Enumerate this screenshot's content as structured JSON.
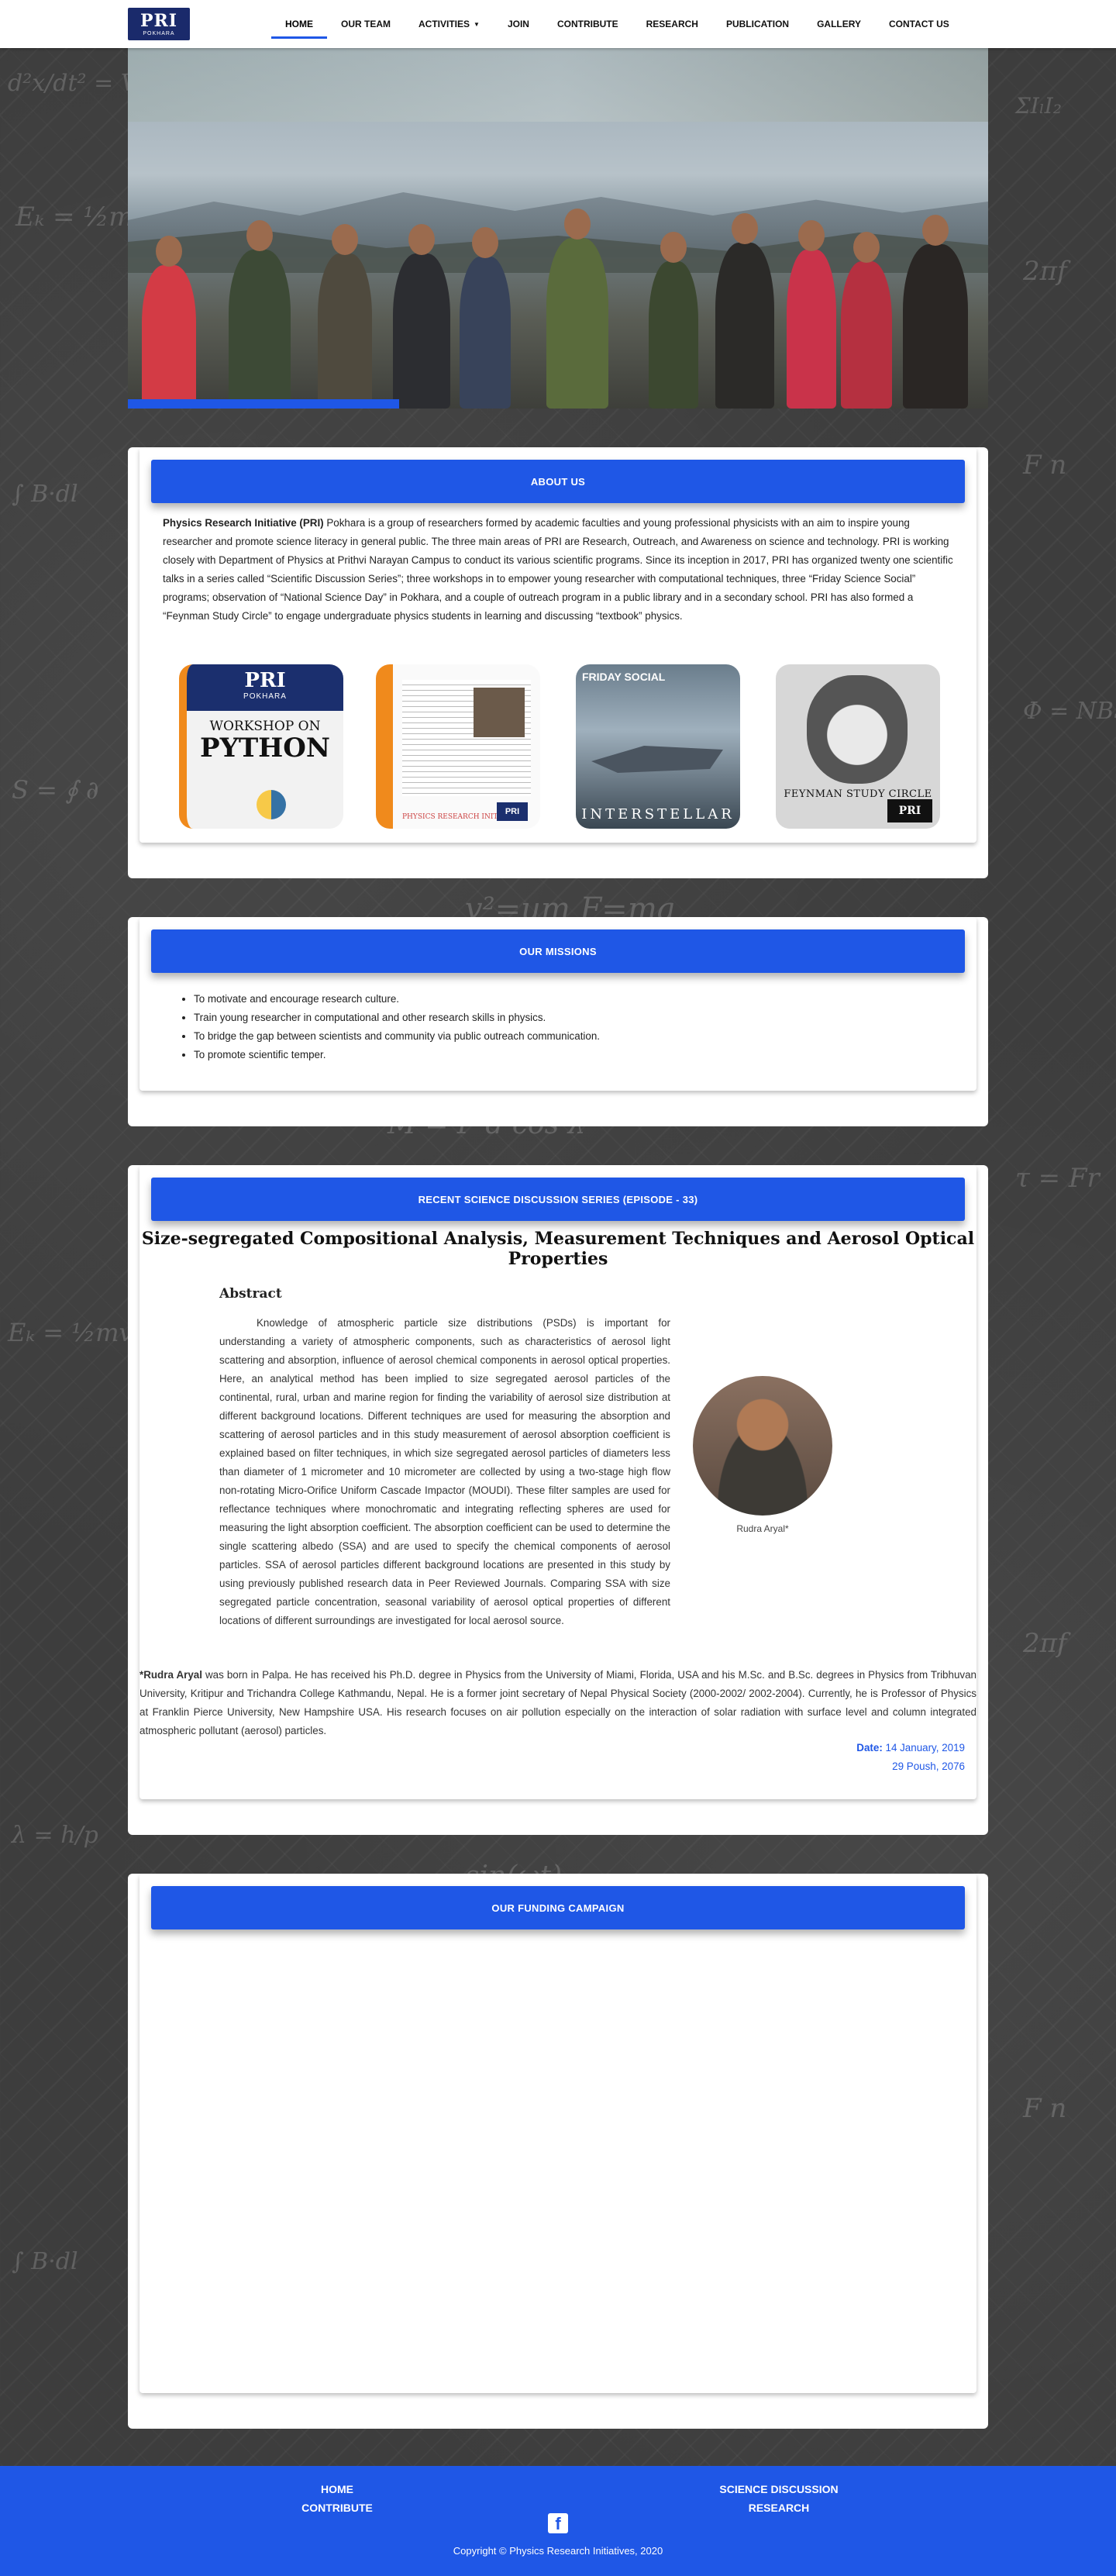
{
  "nav": {
    "logo_text": "PRI",
    "logo_sub": "POKHARA",
    "items": [
      {
        "label": "HOME",
        "active": true
      },
      {
        "label": "OUR TEAM"
      },
      {
        "label": "ACTIVITIES",
        "dropdown": true
      },
      {
        "label": "JOIN"
      },
      {
        "label": "CONTRIBUTE"
      },
      {
        "label": "RESEARCH"
      },
      {
        "label": "PUBLICATION"
      },
      {
        "label": "GALLERY"
      },
      {
        "label": "CONTACT US"
      }
    ]
  },
  "about": {
    "heading": "ABOUT US",
    "org_name": "Physics Research Initiative (PRI)",
    "text": " Pokhara is a group of researchers formed by academic faculties and young professional physicists with an aim to inspire young researcher and promote science literacy in general public. The three main areas of PRI are Research, Outreach, and Awareness on science and technology. PRI is working closely with Department of Physics at Prithvi Narayan Campus to conduct its various scientific programs. Since its inception in 2017, PRI has organized twenty one scientific talks in a series called “Scientific Discussion Series”; three workshops in to empower young researcher with computational techniques, three “Friday Science Social” programs; observation of “National Science Day” in Pokhara, and a couple of outreach program in a public library and in a secondary school. PRI has also formed a “Feynman Study Circle” to engage undergraduate physics students in learning and discussing “textbook” physics.",
    "tiles": {
      "workshop": {
        "pri": "PRI",
        "pokhara": "POKHARA",
        "line1": "WORKSHOP ON",
        "line2": "PYTHON"
      },
      "discussion": {
        "footer": "PHYSICS RESEARCH INITIATIVE",
        "badge": "PRI"
      },
      "friday": {
        "label": "FRIDAY SOCIAL",
        "movie": "INTERSTELLAR"
      },
      "feynman": {
        "label": "FEYNMAN STUDY CIRCLE",
        "badge": "PRI"
      }
    }
  },
  "missions": {
    "heading": "OUR MISSIONS",
    "items": [
      "To motivate and encourage research culture.",
      "Train young researcher in computational and other research skills in physics.",
      "To bridge the gap between scientists and community via public outreach communication.",
      "To promote scientific temper."
    ]
  },
  "talk": {
    "heading": "RECENT SCIENCE DISCUSSION SERIES (EPISODE - 33)",
    "title": "Size-segregated Compositional Analysis, Measurement Techniques and Aerosol Optical Properties",
    "abstract_heading": "Abstract",
    "abstract": "Knowledge of atmospheric particle size distributions (PSDs) is important for understanding a variety of atmospheric components, such as characteristics of aerosol light scattering and absorption, influence of aerosol chemical components in aerosol optical properties. Here, an analytical method has been implied to size segregated aerosol particles of the continental, rural, urban and marine region for finding the variability of aerosol size distribution at different background locations. Different techniques are used for measuring the absorption and scattering of aerosol particles and in this study measurement of aerosol absorption coefficient is explained based on filter techniques, in which size segregated aerosol particles of diameters less than diameter of 1 micrometer and 10 micrometer are collected by using a two-stage high flow non-rotating Micro-Orifice Uniform Cascade Impactor (MOUDI). These filter samples are used for reflectance techniques where monochromatic and integrating reflecting spheres are used for measuring the light absorption coefficient. The absorption coefficient can be used to determine the single scattering albedo (SSA) and are used to specify the chemical components of aerosol particles. SSA of aerosol particles different background locations are presented in this study by using previously published research data in Peer Reviewed Journals. Comparing SSA with size segregated particle concentration, seasonal variability of aerosol optical properties of different locations of different surroundings are investigated for local aerosol source.",
    "speaker_caption": "Rudra Aryal*",
    "bio_name": "*Rudra Aryal",
    "bio": " was born in Palpa. He has received his Ph.D. degree in Physics from the University of Miami, Florida, USA and his M.Sc. and B.Sc. degrees in Physics from Tribhuvan University, Kritipur and Trichandra College Kathmandu, Nepal. He is a former joint secretary of Nepal Physical Society (2000-2002/ 2002-2004). Currently, he is Professor of Physics at Franklin Pierce University, New Hampshire USA. His research focuses on air pollution especially on the interaction of solar radiation with surface level and column integrated atmospheric pollutant (aerosol) particles.",
    "date_label": "Date:",
    "date_en": " 14 January, 2019",
    "date_np": "29 Poush, 2076"
  },
  "funding": {
    "heading": "OUR FUNDING CAMPAIGN"
  },
  "footer": {
    "home": "HOME",
    "contribute": "CONTRIBUTE",
    "science": "SCIENCE DISCUSSION",
    "research": "RESEARCH",
    "facebook": "f",
    "copyright": "Copyright © Physics Research Initiatives, 2020"
  },
  "colors": {
    "accent": "#1f57e6",
    "navy": "#1a2a6b",
    "background": "#3d3d3d"
  }
}
